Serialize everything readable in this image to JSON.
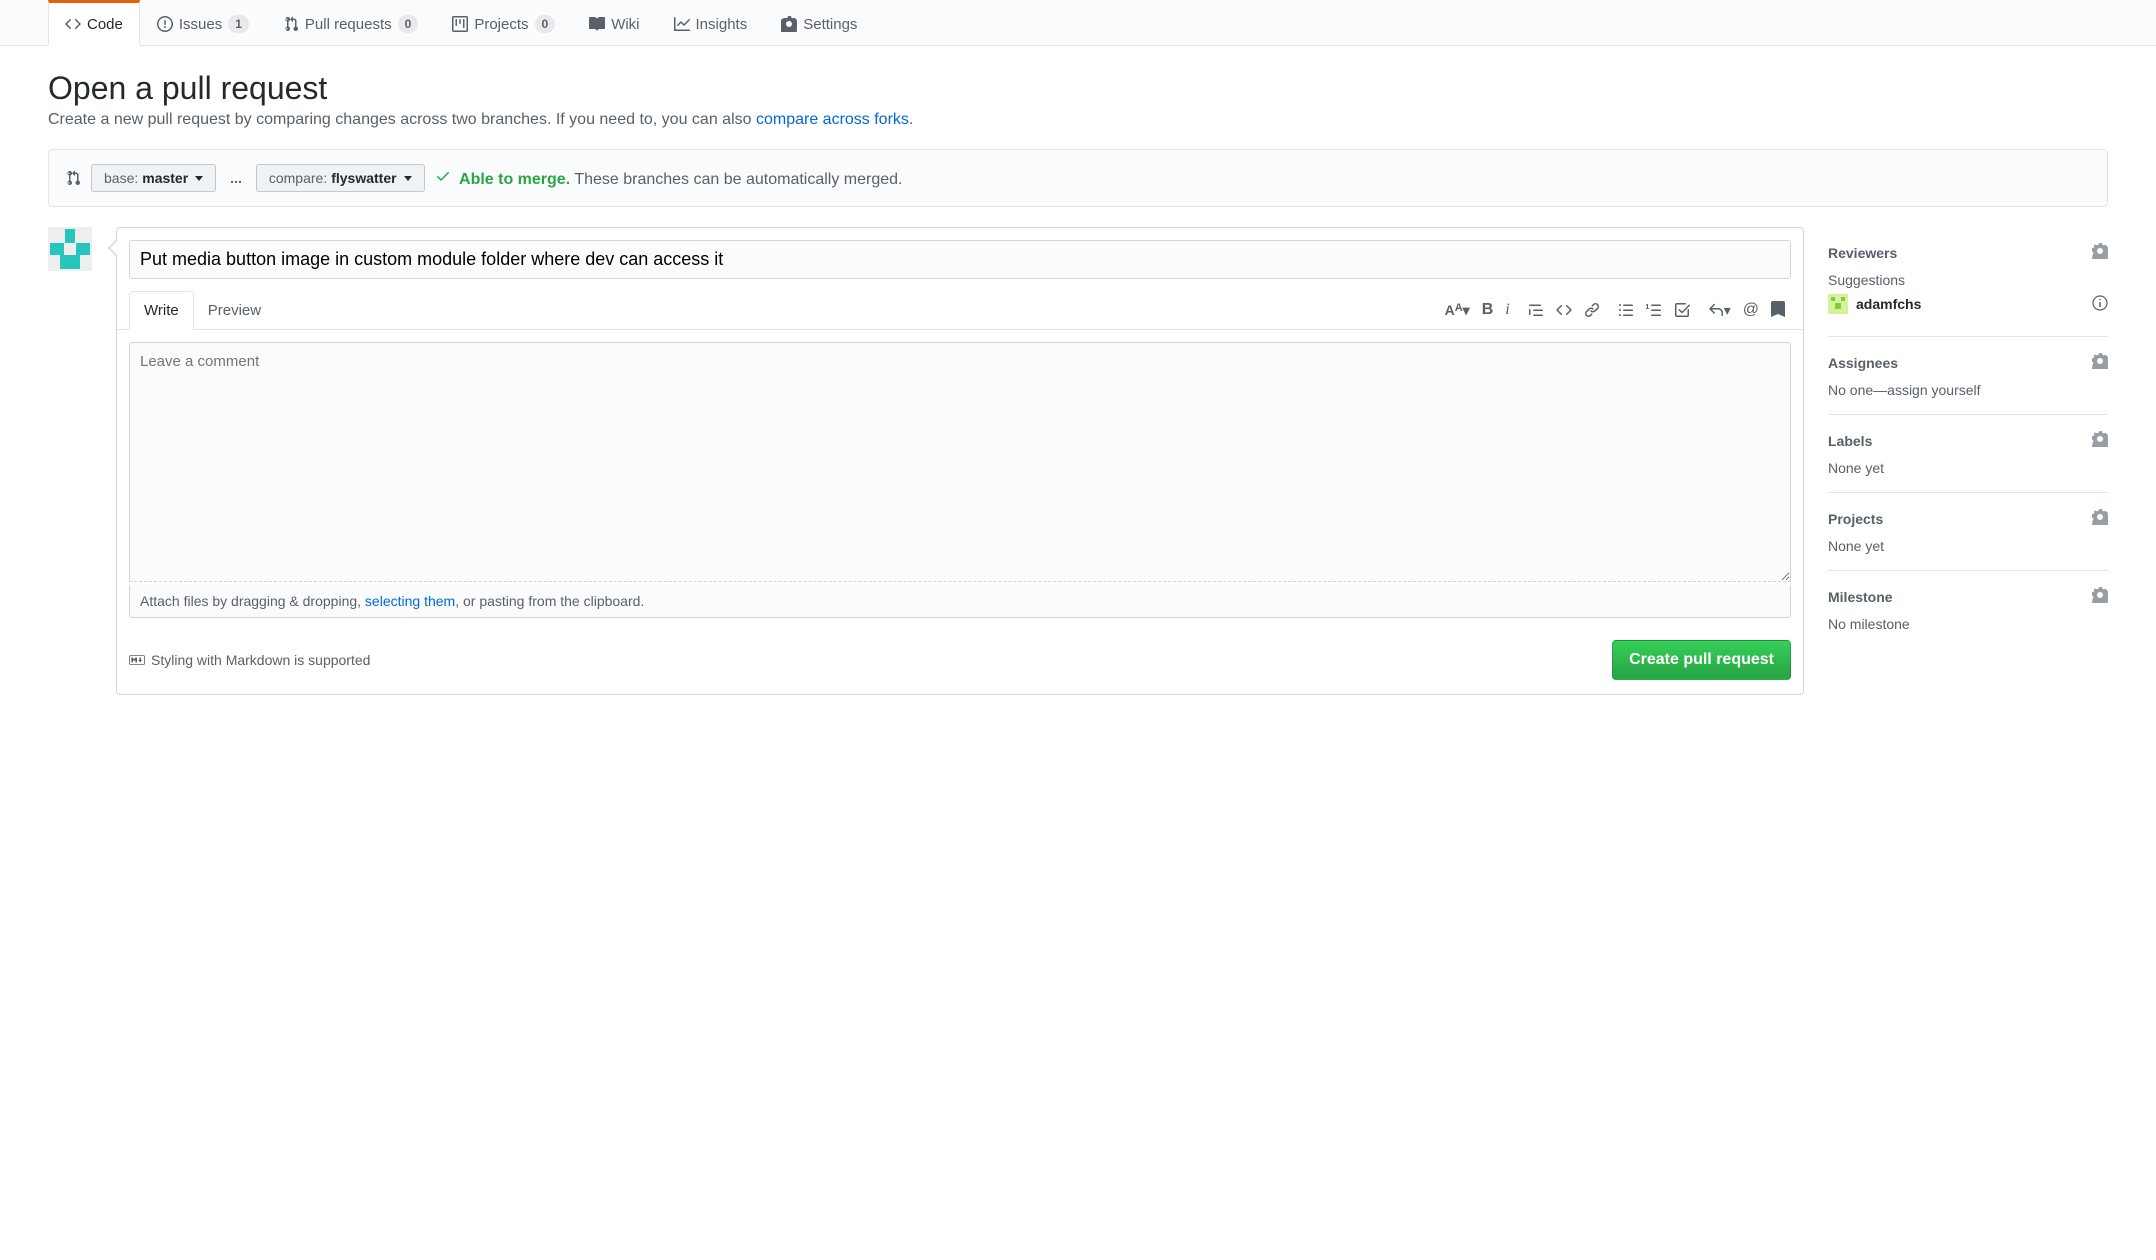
{
  "tabs": {
    "code": "Code",
    "issues": "Issues",
    "issues_count": "1",
    "pull_requests": "Pull requests",
    "pull_requests_count": "0",
    "projects": "Projects",
    "projects_count": "0",
    "wiki": "Wiki",
    "insights": "Insights",
    "settings": "Settings"
  },
  "page": {
    "title": "Open a pull request",
    "subhead_a": "Create a new pull request by comparing changes across two branches. If you need to, you can also ",
    "subhead_link": "compare across forks",
    "subhead_b": "."
  },
  "compare": {
    "base_label": "base: ",
    "base_branch": "master",
    "ellipsis": "...",
    "compare_label": "compare: ",
    "compare_branch": "flyswatter",
    "able": "Able to merge.",
    "msg": " These branches can be automatically merged."
  },
  "form": {
    "title_value": "Put media button image in custom module folder where dev can access it",
    "write_tab": "Write",
    "preview_tab": "Preview",
    "placeholder": "Leave a comment",
    "attach_a": "Attach files by dragging & dropping, ",
    "attach_link": "selecting them",
    "attach_b": ", or pasting from the clipboard.",
    "md_hint": "Styling with Markdown is supported",
    "create_btn": "Create pull request"
  },
  "sidebar": {
    "reviewers_title": "Reviewers",
    "suggestions_label": "Suggestions",
    "suggested_user": "adamfchs",
    "assignees_title": "Assignees",
    "assignees_text_a": "No one—",
    "assignees_link": "assign yourself",
    "labels_title": "Labels",
    "labels_text": "None yet",
    "projects_title": "Projects",
    "projects_text": "None yet",
    "milestone_title": "Milestone",
    "milestone_text": "No milestone"
  }
}
